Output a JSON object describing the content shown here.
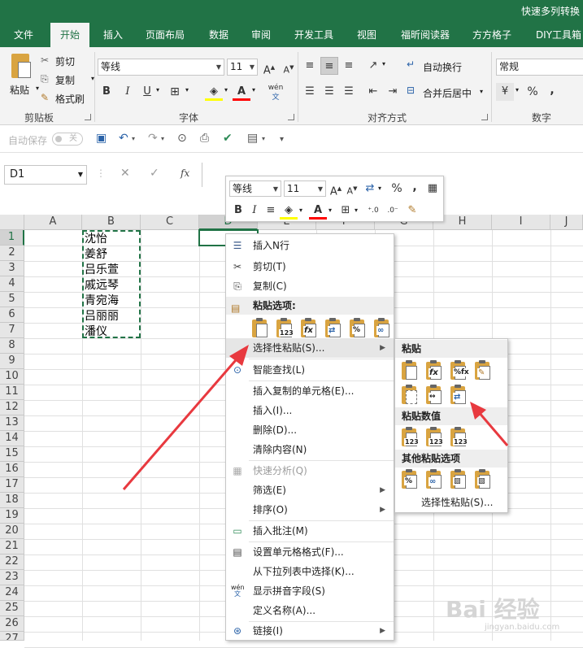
{
  "app": {
    "title": "快速多列转换",
    "brand_color": "#217346"
  },
  "tabs": [
    {
      "label": "文件",
      "active": false
    },
    {
      "label": "开始",
      "active": true
    },
    {
      "label": "插入",
      "active": false
    },
    {
      "label": "页面布局",
      "active": false
    },
    {
      "label": "数据",
      "active": false
    },
    {
      "label": "审阅",
      "active": false
    },
    {
      "label": "开发工具",
      "active": false
    },
    {
      "label": "视图",
      "active": false
    },
    {
      "label": "福昕阅读器",
      "active": false
    },
    {
      "label": "方方格子",
      "active": false
    },
    {
      "label": "DIY工具箱",
      "active": false
    }
  ],
  "ribbon": {
    "clipboard": {
      "paste_label": "粘贴",
      "cut_label": "剪切",
      "copy_label": "复制",
      "format_painter_label": "格式刷",
      "group_label": "剪贴板"
    },
    "font": {
      "font_name": "等线",
      "font_size": "11",
      "bold": "B",
      "italic": "I",
      "underline": "U",
      "grow": "A",
      "shrink": "A",
      "font_color": "A",
      "phonetic": "wén",
      "group_label": "字体"
    },
    "alignment": {
      "wrap_text_label": "自动换行",
      "merge_center_label": "合并后居中",
      "group_label": "对齐方式"
    },
    "number": {
      "format": "常规",
      "currency": "¥",
      "percent": "%",
      "comma": ",",
      "group_label": "数字"
    }
  },
  "qat": {
    "autosave_label": "自动保存",
    "autosave_state": "关"
  },
  "formula_bar": {
    "name_box": "D1",
    "fx": "fx"
  },
  "columns": [
    "A",
    "B",
    "C",
    "D",
    "E",
    "F",
    "G",
    "H",
    "I",
    "J"
  ],
  "rows": [
    "1",
    "2",
    "3",
    "4",
    "5",
    "6",
    "7",
    "8",
    "9",
    "10",
    "11",
    "12",
    "13",
    "14",
    "15",
    "16",
    "17",
    "18",
    "19",
    "20",
    "21",
    "22",
    "23",
    "24",
    "25",
    "26",
    "27"
  ],
  "cells_b": [
    "沈怡",
    "姜舒",
    "吕乐萱",
    "戚远琴",
    "青宛海",
    "吕丽丽",
    "潘仪"
  ],
  "mini_toolbar": {
    "font_name": "等线",
    "font_size": "11",
    "percent": "%",
    "comma": ",",
    "bold": "B",
    "italic": "I"
  },
  "context_menu": {
    "insert_n_rows": "插入N行",
    "cut": "剪切(T)",
    "copy": "复制(C)",
    "paste_options": "粘贴选项:",
    "paste_special": "选择性粘贴(S)...",
    "smart_lookup": "智能查找(L)",
    "insert_copied": "插入复制的单元格(E)...",
    "insert": "插入(I)...",
    "delete": "删除(D)...",
    "clear_contents": "清除内容(N)",
    "quick_analysis": "快速分析(Q)",
    "filter": "筛选(E)",
    "sort": "排序(O)",
    "insert_comment": "插入批注(M)",
    "format_cells": "设置单元格格式(F)...",
    "pick_from_list": "从下拉列表中选择(K)...",
    "show_phonetic": "显示拼音字段(S)",
    "define_name": "定义名称(A)...",
    "link": "链接(I)",
    "paste_icon_label": "123"
  },
  "submenu": {
    "paste": "粘贴",
    "paste_values": "粘贴数值",
    "other_paste_options": "其他粘贴选项",
    "paste_special": "选择性粘贴(S)...",
    "values_label": "123"
  },
  "watermark": {
    "brand": "Bai 经验",
    "url": "jingyan.baidu.com"
  },
  "colors": {
    "annotation_arrow": "#e8393f",
    "selection_green": "#217346"
  }
}
